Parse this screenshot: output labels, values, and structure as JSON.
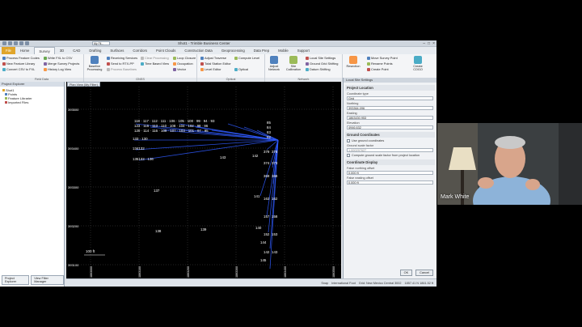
{
  "app": {
    "title": "Shot1 - Trimble Business Center",
    "file_combo": "My Fil..."
  },
  "menu_tabs": [
    {
      "label": "File"
    },
    {
      "label": "Home"
    },
    {
      "label": "Survey"
    },
    {
      "label": "3D"
    },
    {
      "label": "CAD"
    },
    {
      "label": "Drafting"
    },
    {
      "label": "Surfaces"
    },
    {
      "label": "Corridors"
    },
    {
      "label": "Point Clouds"
    },
    {
      "label": "Construction Data"
    },
    {
      "label": "Geoprocessing"
    },
    {
      "label": "Data Prep"
    },
    {
      "label": "Mobile"
    },
    {
      "label": "Support"
    }
  ],
  "ribbon": {
    "groups": [
      {
        "label": "Field Data"
      },
      {
        "label": "GNSS"
      },
      {
        "label": "Optical"
      },
      {
        "label": "Network"
      },
      {
        "label": "COGO"
      }
    ],
    "items": {
      "process_feature_codes": "Process Feature Codes",
      "write_fxl_to_csv": "Write FXL to CSV",
      "new_feature_library": "New Feature Library",
      "merge_survey_projects": "Merge Survey Projects",
      "convert_csv_to_fxl": "Convert CSV to FXL",
      "history_log_view": "History Log View",
      "baseline_processing": "Baseline Processing",
      "receiving_services": "Receiving Services",
      "clear_processing": "Clear Processing",
      "send_to_rtx_pp": "Send to RTX-PP",
      "time_based_view": "Time Based View",
      "process_baselines": "Process Baselines",
      "loop_closure": "Loop Closure",
      "occupation": "Occupation",
      "vector": "Vector",
      "adjust_traverse": "Adjust Traverse",
      "compute_level": "Compute Level",
      "total_station_editor": "Total Station Editor",
      "level_editor": "Level Editor",
      "optical": "Optical",
      "adjust_network": "Adjust Network",
      "site_calibration": "Site Calibration",
      "local_site_settings": "Local Site Settings",
      "ground_grid_shifting": "Ground Grid Shifting",
      "datum_grid_shift": "Datum Shifting",
      "resection": "Resection",
      "move_survey_point": "Move Survey Point",
      "rename_points": "Rename Points",
      "create_point": "Create Point",
      "create_cogo": "Create COGO",
      "survey_events": "Survey Events"
    }
  },
  "explorer": {
    "title": "Project Explorer",
    "tree": [
      {
        "label": "Shot1"
      },
      {
        "label": "Points"
      },
      {
        "label": "Feature Librarier"
      },
      {
        "label": "Imported Files"
      }
    ],
    "tabs": [
      {
        "label": "Project Explorer"
      },
      {
        "label": "View Filter Manager"
      }
    ]
  },
  "plan_view": {
    "tab": "Plan View (My Filter)",
    "scale_label": "100 ft",
    "y_ticks": [
      "393500",
      "393400",
      "393300",
      "393200",
      "393100"
    ],
    "x_ticks": [
      "1863000",
      "1863100",
      "1863200",
      "1863300",
      "1863400",
      "1863500"
    ],
    "points_top": "118 · 117 · 112 · 111 · 106 · 105 · 100 · 99 · 94 · 93",
    "points_row2": "123 · 115 · 113 · 110 · 108 · 104 · 102 · 98 · 96",
    "points_row3": "120 · 114 · 116 · 109 · 107 · 103 · 101 · 97 · 95",
    "points_left_a": "133 · 130",
    "points_left_b": "134132",
    "points_left_c": "135133 · 136",
    "points_col": [
      "85",
      "84",
      "83",
      "82"
    ],
    "points_right": [
      "379",
      "378",
      "374",
      "373",
      "369",
      "368",
      "163",
      "162",
      "157",
      "158",
      "152",
      "153",
      "142",
      "143"
    ],
    "labels": {
      "p137": "137",
      "p138": "138",
      "p139": "139",
      "p140": "140",
      "p141": "141",
      "p142": "142",
      "p143": "143",
      "p144": "144",
      "p145": "145"
    }
  },
  "status": {
    "snap": "Snap",
    "units": "International Foot",
    "coords_sys": "Grid: New Mexico Central 3002",
    "coords": "1857.41 N 1861.52 ft"
  },
  "dialog": {
    "title": "Local Site Settings",
    "section_project": "Project Location",
    "coord_type_label": "Coordinate type",
    "coord_type_value": "Grid",
    "northing_label": "Northing",
    "northing_value": "393364.096",
    "easting_label": "Easting",
    "easting_value": "1863430.953",
    "elevation_label": "Elevation",
    "elevation_value": "4946.632",
    "section_ground": "Ground Coordinates",
    "use_ground": "Use ground coordinates",
    "ground_scale_label": "Ground scale factor",
    "ground_scale_value": "1.000297627",
    "compute_scale": "Compute ground scale factor from project location",
    "section_display": "Coordinate Display",
    "false_northing_label": "False northing offset",
    "false_northing_value": "0.000 ft",
    "false_easting_label": "False easting offset",
    "false_easting_value": "0.000 ft",
    "ok": "OK",
    "cancel": "Cancel"
  },
  "webcam": {
    "name": "Mark White"
  }
}
